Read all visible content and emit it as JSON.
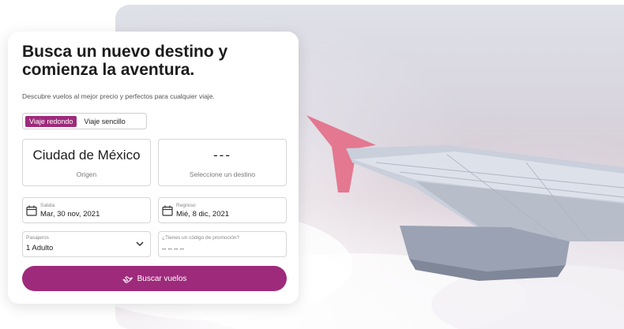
{
  "card": {
    "title": "Busca un nuevo destino y comienza la aventura.",
    "subtitle": "Descubre vuelos al mejor precio y perfectos para cualquier viaje."
  },
  "trip_type": {
    "round_trip": "Viaje redondo",
    "one_way": "Viaje sencillo",
    "selected": "Viaje redondo"
  },
  "origin": {
    "value": "Ciudad de México",
    "label": "Origen"
  },
  "destination": {
    "value": "---",
    "label": "Seleccione un destino"
  },
  "departure": {
    "label": "Salida",
    "value": "Mar, 30 nov, 2021"
  },
  "return": {
    "label": "Regreso",
    "value": "Mié, 8 dic, 2021"
  },
  "passengers": {
    "label": "Pasajeros",
    "value": "1 Adulto"
  },
  "promo": {
    "label": "¿Tienes un código de promoción?",
    "value": "-- -- -- --"
  },
  "search_button": {
    "label": "Buscar vuelos"
  },
  "colors": {
    "accent": "#9e2a7b",
    "wing_tip": "#e36d86"
  },
  "icons": [
    "calendar-icon",
    "chevron-down-icon",
    "airplane-icon"
  ]
}
